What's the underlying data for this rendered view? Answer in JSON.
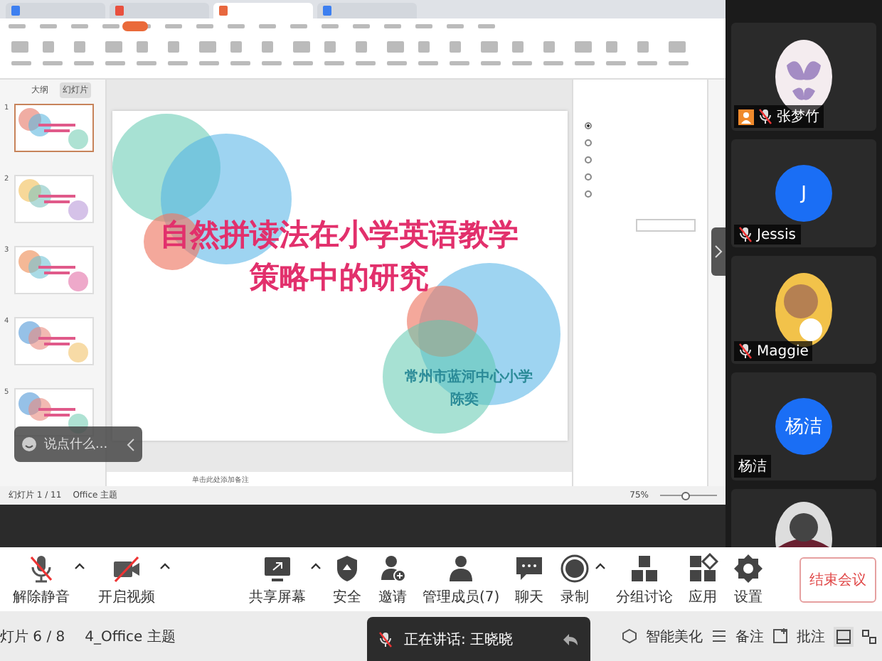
{
  "wps": {
    "doc_tabs": [
      {
        "color": "#3d7ff0",
        "selected": false
      },
      {
        "color": "#e8503e",
        "selected": false
      },
      {
        "color": "#e8673e",
        "selected": true
      },
      {
        "color": "#3d7ff0",
        "selected": false
      }
    ],
    "panel_tabs": [
      {
        "label": "大纲",
        "selected": false
      },
      {
        "label": "幻灯片",
        "selected": true
      }
    ],
    "thumbnails": [
      {
        "number": "1",
        "selected": true
      },
      {
        "number": "2",
        "selected": false
      },
      {
        "number": "3",
        "selected": false
      },
      {
        "number": "4",
        "selected": false
      },
      {
        "number": "5",
        "selected": false
      }
    ],
    "slide": {
      "title_lines": [
        "自然拼读法在小学英语教学",
        "策略中的研究"
      ],
      "school": "常州市蓝河中心小学",
      "author": "陈奕"
    },
    "notes_placeholder": "单击此处添加备注",
    "property_options": [
      {
        "selected": true
      },
      {
        "selected": false
      },
      {
        "selected": false
      },
      {
        "selected": false
      },
      {
        "selected": false
      }
    ],
    "status": {
      "slide_count": "幻灯片 1 / 11",
      "theme": "Office 主题",
      "zoom": "75%",
      "zoom_slider": {
        "level": 0.45
      }
    }
  },
  "chat_box": {
    "placeholder": "说点什么..."
  },
  "participants": [
    {
      "name": "张梦竹",
      "kind": "picture",
      "host": true,
      "muted": true
    },
    {
      "name": "Jessis",
      "kind": "letter",
      "letter": "J",
      "host": false,
      "muted": true
    },
    {
      "name": "Maggie",
      "kind": "picture",
      "host": false,
      "muted": true
    },
    {
      "name": "杨洁",
      "kind": "letter",
      "letter": "杨洁",
      "host": false,
      "muted": false
    },
    {
      "kind": "picture",
      "host": false,
      "muted": false
    }
  ],
  "toolbar": {
    "items": [
      {
        "label": "解除静音",
        "menu": true
      },
      {
        "label": "开启视频",
        "menu": true
      },
      {
        "label": "共享屏幕",
        "menu": true
      },
      {
        "label": "安全",
        "menu": false
      },
      {
        "label": "邀请",
        "menu": false
      },
      {
        "label": "管理成员(7)",
        "menu": false
      },
      {
        "label": "聊天",
        "menu": false
      },
      {
        "label": "录制",
        "menu": true
      },
      {
        "label": "分组讨论",
        "menu": false
      },
      {
        "label": "应用",
        "menu": false
      },
      {
        "label": "设置",
        "menu": false
      }
    ],
    "end_button": "结束会议"
  },
  "status_bar": {
    "slide_position": "灯片 6 / 8",
    "theme": "4_Office 主题",
    "speaking": "正在讲话: 王晓晓",
    "beautify": "智能美化",
    "notes": "备注",
    "comments": "批注"
  }
}
